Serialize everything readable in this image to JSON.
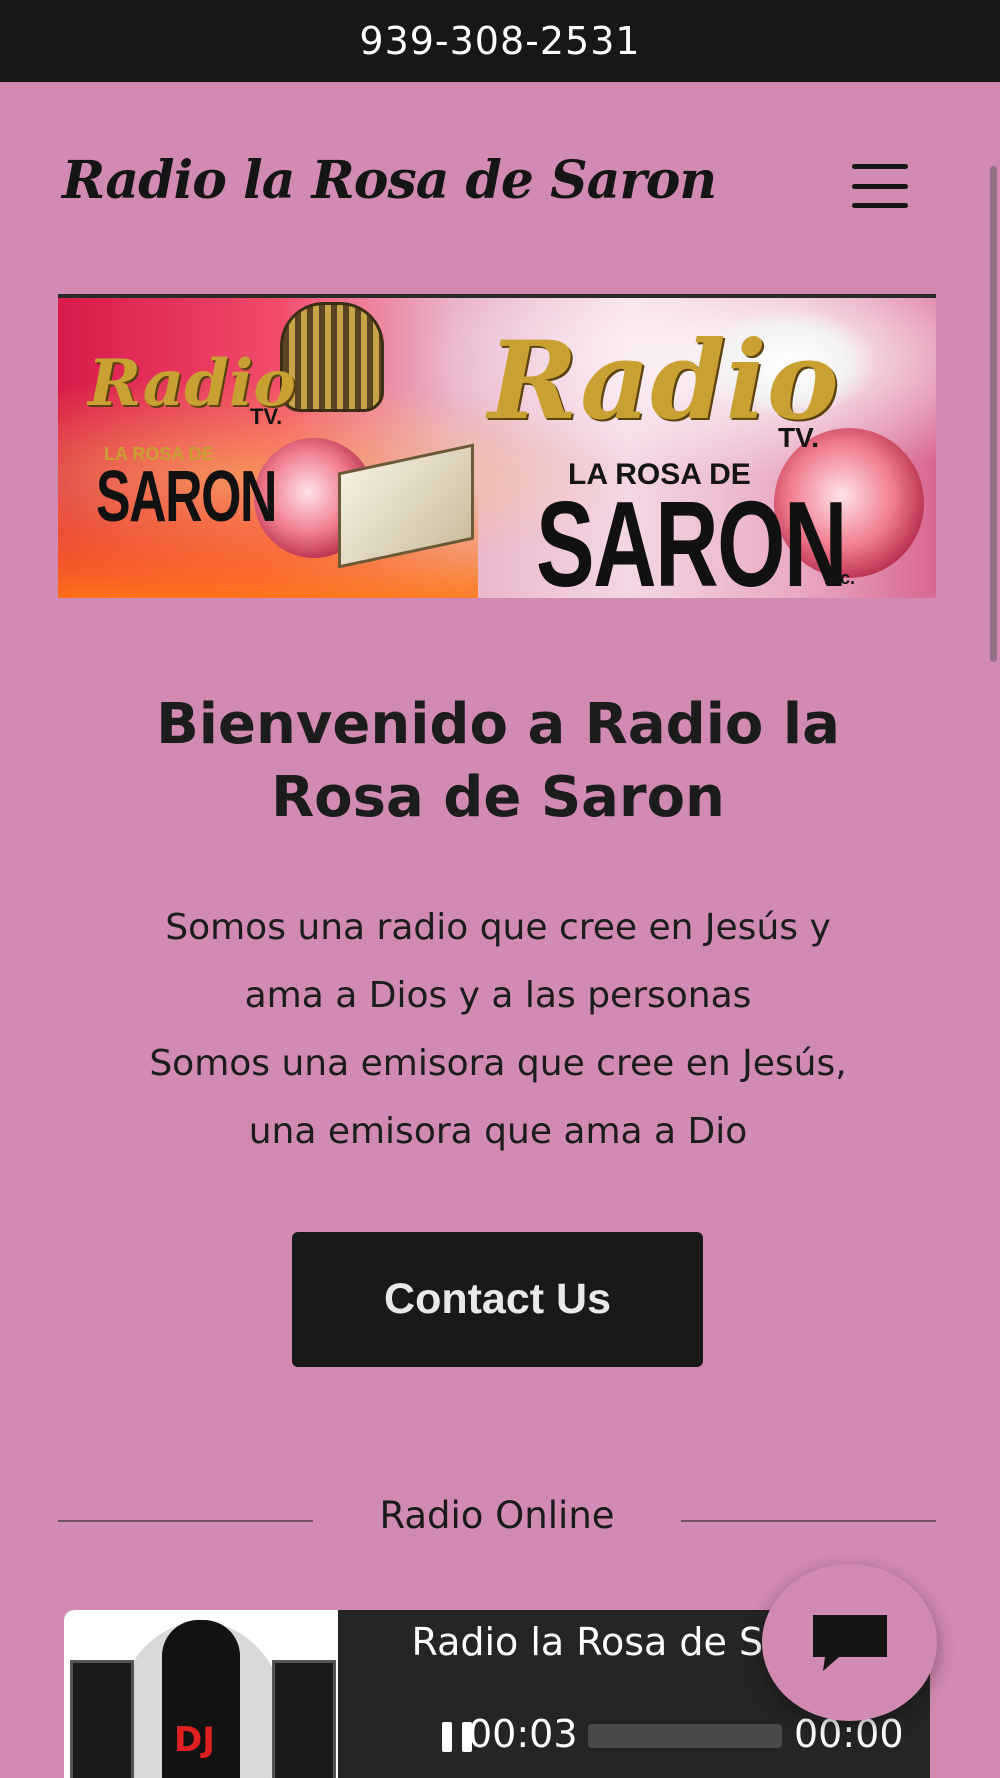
{
  "topbar": {
    "phone": "939-308-2531"
  },
  "header": {
    "brand": "Radio la Rosa de Saron",
    "menu_icon": "hamburger-menu-icon"
  },
  "banner": {
    "logo_left": {
      "script": "Radio",
      "tv": "TV.",
      "sub": "LA ROSA DE",
      "name": "SARON"
    },
    "logo_right": {
      "script": "Radio",
      "tv": "TV.",
      "sub": "LA ROSA DE",
      "name": "SARON",
      "suffix": "Inc."
    }
  },
  "hero": {
    "title": "Bienvenido a Radio la Rosa de Saron",
    "lines": [
      "Somos una radio que cree en Jesús y",
      "ama a Dios y a las personas",
      "Somos una emisora que cree en Jesús,",
      "una emisora que ama a Dio"
    ],
    "cta_label": "Contact Us"
  },
  "radio": {
    "section_label": "Radio Online",
    "title": "Radio la Rosa de Saron",
    "current_time": "00:03",
    "duration": "00:00",
    "progress": 0,
    "cover_text": "DJ",
    "state": "playing"
  },
  "chat": {
    "icon": "chat-bubble-icon"
  },
  "colors": {
    "page_bg": "#d18ab2",
    "topbar_bg": "#171717",
    "button_bg": "#191919",
    "player_bg": "#252525"
  }
}
